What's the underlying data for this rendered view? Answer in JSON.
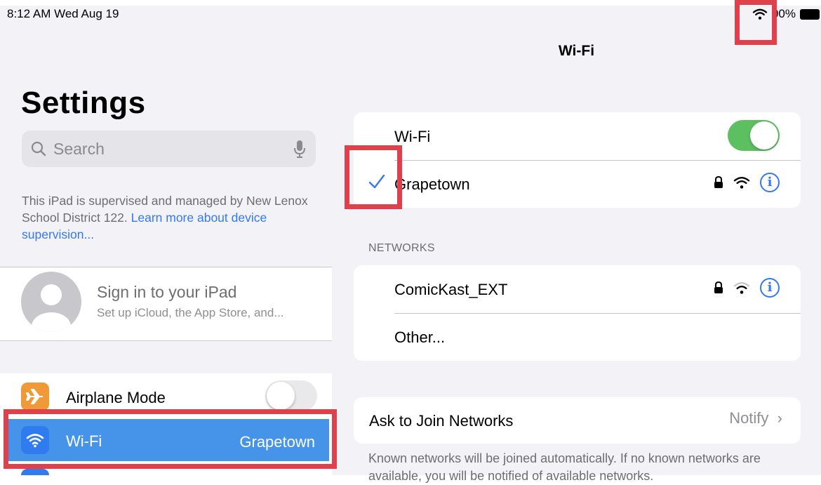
{
  "status_bar": {
    "time_date": "8:12 AM  Wed Aug 19",
    "battery_text": "00%",
    "icons": [
      "wifi-icon",
      "battery-icon"
    ]
  },
  "sidebar": {
    "title": "Settings",
    "search": {
      "placeholder": "Search",
      "icons": [
        "search-icon",
        "mic-icon"
      ]
    },
    "supervision": {
      "text": "This iPad is supervised and managed by New Lenox School District 122. ",
      "link_text": "Learn more about device supervision..."
    },
    "account": {
      "title": "Sign in to your iPad",
      "subtitle": "Set up iCloud, the App Store, and..."
    },
    "items": [
      {
        "label": "Airplane Mode",
        "icon": "airplane-icon",
        "icon_color": "#f09a37",
        "toggle": false
      },
      {
        "label": "Wi-Fi",
        "icon": "wifi-icon",
        "icon_color": "#2f7bf0",
        "value": "Grapetown",
        "selected": true
      }
    ]
  },
  "detail": {
    "title": "Wi-Fi",
    "wifi_toggle": {
      "label": "Wi-Fi",
      "on": true
    },
    "connected_network": {
      "name": "Grapetown",
      "icons": [
        "lock-icon",
        "wifi-icon",
        "info-icon"
      ]
    },
    "networks_header": "NETWORKS",
    "networks": [
      {
        "name": "ComicKast_EXT",
        "icons": [
          "lock-icon",
          "wifi-icon",
          "info-icon"
        ]
      },
      {
        "name": "Other..."
      }
    ],
    "ask_to_join": {
      "label": "Ask to Join Networks",
      "value": "Notify"
    },
    "footer": "Known networks will be joined automatically. If no known networks are available, you will be notified of available networks."
  },
  "colors": {
    "accent_blue": "#3478f6",
    "toggle_green": "#5cbf60",
    "highlight_red": "#e0404b",
    "selected_row": "#4693ea"
  }
}
